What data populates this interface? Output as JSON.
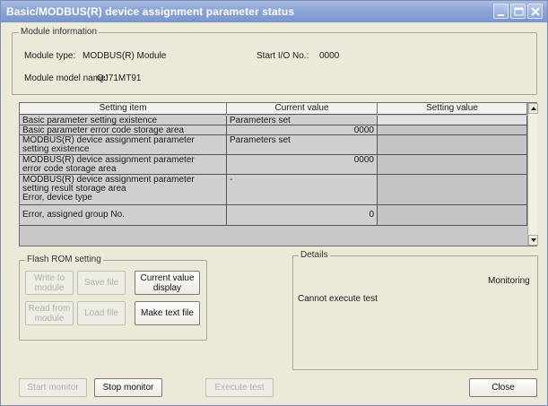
{
  "window": {
    "title": "Basic/MODBUS(R) device assignment parameter status",
    "controls": [
      "minimize-icon",
      "maximize-icon",
      "close-icon"
    ]
  },
  "module_info": {
    "legend": "Module information",
    "type_label": "Module type:",
    "type_value": "MODBUS(R) Module",
    "start_io_label": "Start I/O No.:",
    "start_io_value": "0000",
    "model_label": "Module model name:",
    "model_value": "QJ71MT91"
  },
  "table": {
    "columns": [
      "Setting item",
      "Current value",
      "Setting value"
    ],
    "rows": [
      {
        "item": "Basic parameter setting existence",
        "current": "Parameters set",
        "setting": ""
      },
      {
        "item": "Basic parameter error code storage area",
        "current": "0000",
        "setting": ""
      },
      {
        "item": "MODBUS(R) device assignment parameter\nsetting existence",
        "current": "Parameters set",
        "setting": ""
      },
      {
        "item": "MODBUS(R) device assignment parameter\nerror code storage area",
        "current": "0000",
        "setting": ""
      },
      {
        "item": "MODBUS(R) device assignment parameter\nsetting result storage area\n Error, device type",
        "current": "-",
        "setting": ""
      },
      {
        "item": " Error, assigned group No.",
        "current": "0",
        "setting": ""
      }
    ]
  },
  "flash_rom": {
    "legend": "Flash ROM setting",
    "write_to_module": "Write to\nmodule",
    "save_file": "Save file",
    "read_from_module": "Read from\nmodule",
    "load_file": "Load file",
    "current_value_display": "Current value\ndisplay",
    "make_text_file": "Make text file"
  },
  "details": {
    "legend": "Details",
    "status": "Monitoring",
    "message": "Cannot execute test"
  },
  "footer": {
    "start_monitor": "Start monitor",
    "stop_monitor": "Stop monitor",
    "execute_test": "Execute test",
    "close": "Close"
  },
  "colors": {
    "dialog_bg": "#ece9d8",
    "title_gradient_top": "#a9bce0",
    "title_gradient_bottom": "#7a96cf",
    "grid_cell": "#cfcfcf",
    "disabled_text": "#b3b1a6"
  }
}
